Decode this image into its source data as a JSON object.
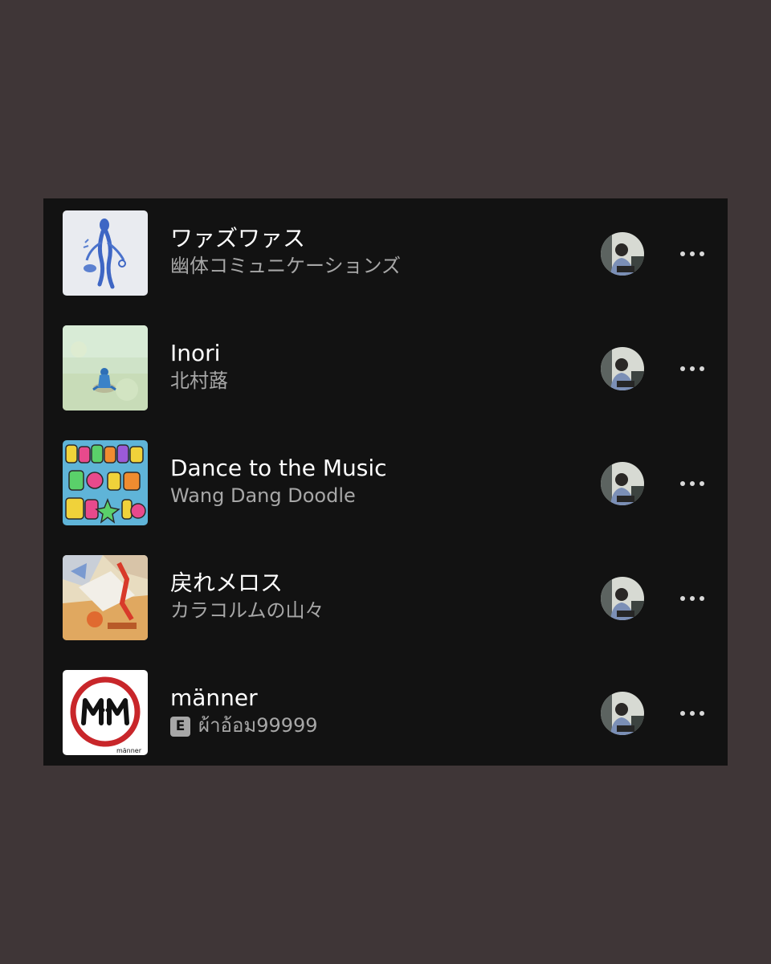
{
  "tracks": [
    {
      "title": "ワァズワァス",
      "artist": "幽体コミュニケーションズ",
      "explicit": false,
      "cover_icon": "figure-art-cover"
    },
    {
      "title": "Inori",
      "artist": "北村蕗",
      "explicit": false,
      "cover_icon": "sitting-figure-cover"
    },
    {
      "title": "Dance to the Music",
      "artist": "Wang Dang Doodle",
      "explicit": false,
      "cover_icon": "colorful-lettering-cover"
    },
    {
      "title": "戻れメロス",
      "artist": "カラコルムの山々",
      "explicit": false,
      "cover_icon": "painted-collage-cover"
    },
    {
      "title": "männer",
      "artist": "ผ้าอ้อม99999",
      "explicit": true,
      "explicit_label": "E",
      "cover_icon": "prohibition-sign-cover",
      "cover_caption": "männer"
    }
  ],
  "colors": {
    "background": "#3f3637",
    "panel": "#121212",
    "title": "#ffffff",
    "subtitle": "#a7a7a7"
  }
}
